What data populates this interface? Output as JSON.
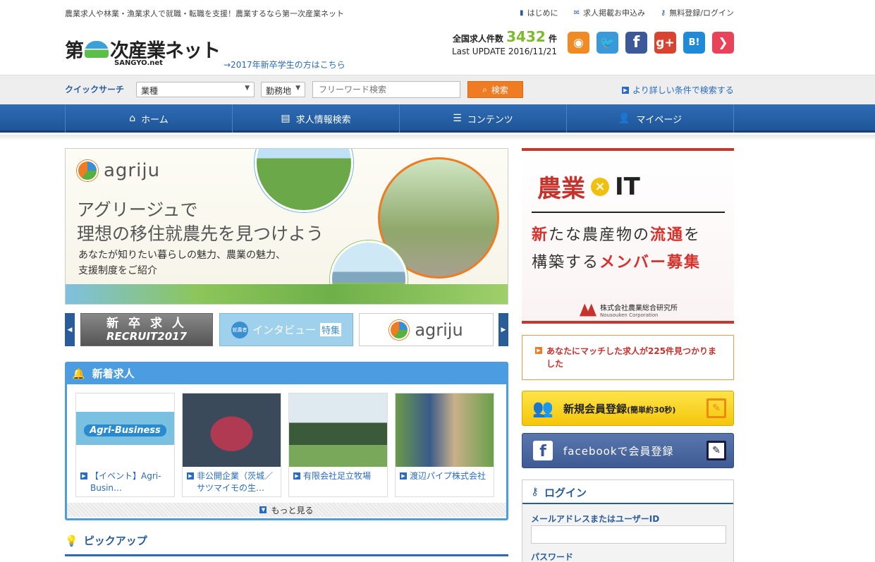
{
  "topbar": {
    "tagline": "農業求人や林業・漁業求人で就職・転職を支援！農業するなら第一次産業ネット",
    "links": [
      "はじめに",
      "求人掲載お申込み",
      "無料登録/ログイン"
    ]
  },
  "header": {
    "logo_left": "第",
    "logo_right": "次産業ネット",
    "logo_sub": "SANGYO.net",
    "grad_link": "→2017年新卒学生の方はこちら",
    "count_label": "全国求人件数",
    "count_value": "3432",
    "count_unit": "件",
    "update": "Last UPDATE 2016/11/21"
  },
  "social": [
    {
      "name": "rss",
      "glyph": "◉",
      "color": "#f08a24"
    },
    {
      "name": "twitter",
      "glyph": "🐦",
      "color": "#3a9ad9"
    },
    {
      "name": "facebook",
      "glyph": "f",
      "color": "#3b5998"
    },
    {
      "name": "googleplus",
      "glyph": "g+",
      "color": "#d8442f"
    },
    {
      "name": "hatena",
      "glyph": "B!",
      "color": "#1f8ad8"
    },
    {
      "name": "pocket",
      "glyph": "❯",
      "color": "#e8435a"
    }
  ],
  "quicksearch": {
    "label": "クイックサーチ",
    "industry": "業種",
    "location": "勤務地",
    "keyword_placeholder": "フリーワード検索",
    "search_btn": "検索",
    "advanced": "より詳しい条件で検索する"
  },
  "nav": {
    "home": "ホーム",
    "search": "求人情報検索",
    "contents": "コンテンツ",
    "mypage": "マイページ"
  },
  "hero": {
    "brand": "agriju",
    "line1": "アグリージュで",
    "line2": "理想の移住就農先を見つけよう",
    "sub1": "あなたが知りたい暮らしの魅力、農業の魅力、",
    "sub2": "支援制度をご紹介"
  },
  "carousel": {
    "item1_top": "新 卒 求 人",
    "item1_bottom": "RECRUIT2017",
    "item2_badge": "就農者",
    "item2_text": "インタビュー",
    "item2_tag": "特集",
    "item3": "agriju"
  },
  "newjobs": {
    "title": "新着求人",
    "jobs": [
      {
        "line1": "【イベント】Agri-",
        "line2": "Busin…"
      },
      {
        "line1": "非公開企業（茨城／",
        "line2": "サツマイモの生…"
      },
      {
        "line1": "有限会社足立牧場",
        "line2": ""
      },
      {
        "line1": "渡辺パイプ株式会社",
        "line2": ""
      }
    ],
    "job1_banner": "Agri-Business",
    "more": "もっと見る"
  },
  "pickup": {
    "title": "ピックアップ"
  },
  "ad": {
    "word1": "農業",
    "x": "×",
    "word2": "IT",
    "l2_a": "新",
    "l2_b": "たな農産物の",
    "l2_c": "流通",
    "l2_d": "を",
    "l3_a": "構築する",
    "l3_b": "メンバー募集",
    "company": "株式会社農業総合研究所",
    "company_en": "Nousouken Corporation"
  },
  "match": {
    "text": "あなたにマッチした求人が225件見つかりました"
  },
  "register": {
    "label": "新規会員登録",
    "note": "(簡単約30秒)"
  },
  "facebook": {
    "label": "facebookで会員登録"
  },
  "login": {
    "title": "ログイン",
    "email_label": "メールアドレスまたはユーザーID",
    "password_label": "パスワード"
  }
}
